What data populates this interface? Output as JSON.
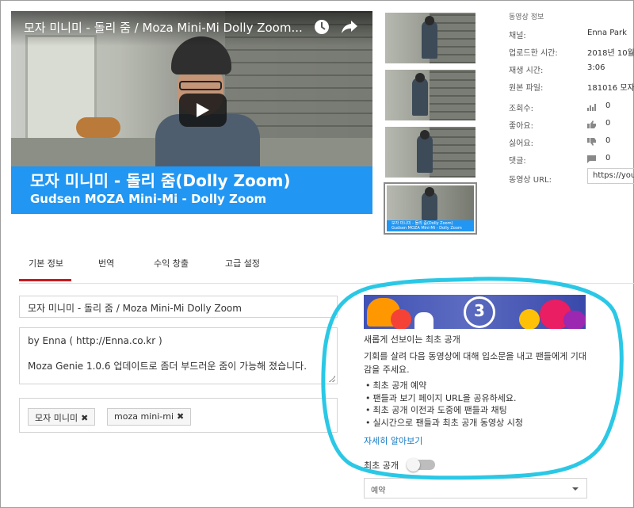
{
  "video": {
    "title": "모자 미니미 - 돌리 줌 / Moza Mini-Mi Dolly Zoom...",
    "banner_line1": "모자 미니미 - 돌리 줌(Dolly Zoom)",
    "banner_line2": "Gudsen MOZA Mini-Mi - Dolly Zoom"
  },
  "thumbnails": {
    "selected_banner_line1": "모자 미니미 - 돌리 줌(Dolly Zoom)",
    "selected_banner_line2": "Gudsen MOZA Mini-Mi - Dolly Zoom"
  },
  "info": {
    "heading": "동영상 정보",
    "channel_label": "채널:",
    "channel_value": "Enna Park",
    "uploaded_label": "업로드한 시간:",
    "uploaded_value": "2018년 10월",
    "duration_label": "재생 시간:",
    "duration_value": "3:06",
    "file_label": "원본 파일:",
    "file_value": "181016 모자",
    "views_label": "조회수:",
    "views_value": "0",
    "likes_label": "좋아요:",
    "likes_value": "0",
    "dislikes_label": "싫어요:",
    "dislikes_value": "0",
    "comments_label": "댓글:",
    "comments_value": "0",
    "url_label": "동영상 URL:",
    "url_value": "https://you"
  },
  "tabs": [
    {
      "label": "기본 정보"
    },
    {
      "label": "번역"
    },
    {
      "label": "수익 창출"
    },
    {
      "label": "고급 설정"
    }
  ],
  "form": {
    "title_value": "모자 미니미 - 돌리 줌 / Moza Mini-Mi Dolly Zoom",
    "description_line1": "by Enna ( http://Enna.co.kr )",
    "description_line2": "Moza Genie 1.0.6 업데이트로 좀더 부드러운 줌이 가능해 졌습니다.",
    "tags": [
      "모자 미니미",
      "moza mini-mi"
    ],
    "tag_remove": "✖"
  },
  "premiere": {
    "banner_number": "3",
    "title": "새롭게 선보이는 최초 공개",
    "description": "기회를 살려 다음 동영상에 대해 입소문을 내고 팬들에게 기대감을 주세요.",
    "bullets": [
      "최초 공개 예약",
      "팬들과 보기 페이지 URL을 공유하세요.",
      "최초 공개 이전과 도중에 팬들과 채팅",
      "실시간으로 팬들과 최초 공개 동영상 시청"
    ],
    "learn_more": "자세히 알아보기",
    "toggle_label": "최초 공개",
    "toggle_on": false,
    "select_value": "예약"
  },
  "colors": {
    "accent_red": "#cc181e",
    "link_blue": "#167ac6",
    "banner_blue": "#2196f3",
    "highlight_cyan": "#2bc8e6"
  }
}
